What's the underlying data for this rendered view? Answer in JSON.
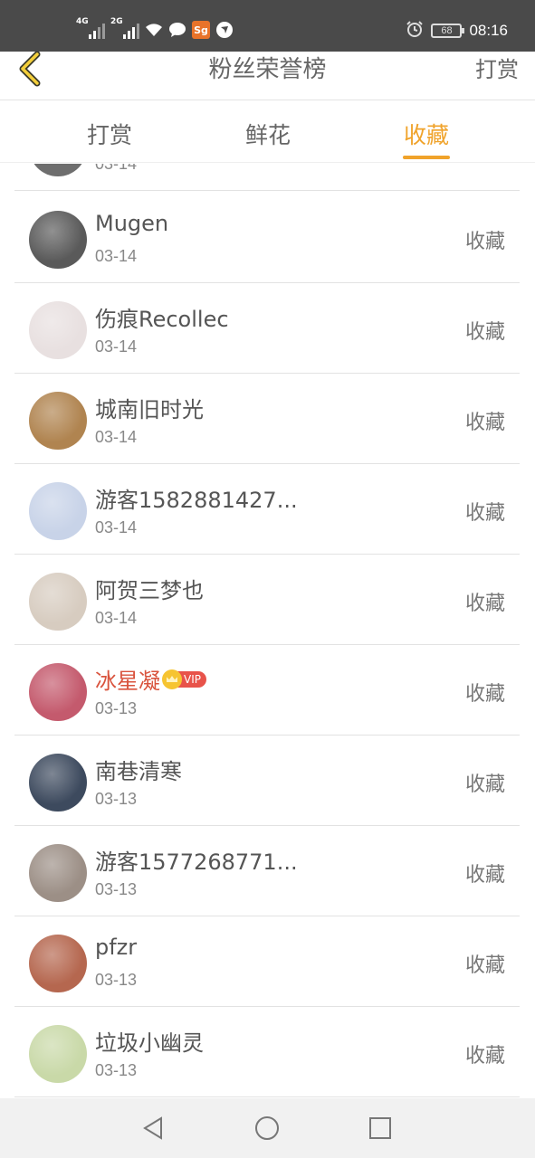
{
  "status_bar": {
    "signal1_label": "4G",
    "signal2_label": "2G",
    "app_badge": "Sg",
    "battery": "68",
    "time": "08:16"
  },
  "header": {
    "title": "粉丝荣誉榜",
    "action": "打赏"
  },
  "tabs": [
    {
      "label": "打赏",
      "active": false
    },
    {
      "label": "鲜花",
      "active": false
    },
    {
      "label": "收藏",
      "active": true
    }
  ],
  "list": {
    "partial_date": "03-14",
    "items": [
      {
        "name": "Mugen",
        "date": "03-14",
        "action": "收藏",
        "vip": false,
        "avatar_color": "#5a5a5a"
      },
      {
        "name": "伤痕Recollec",
        "date": "03-14",
        "action": "收藏",
        "vip": false,
        "avatar_color": "#e8e0e0"
      },
      {
        "name": "城南旧时光",
        "date": "03-14",
        "action": "收藏",
        "vip": false,
        "avatar_color": "#b08450"
      },
      {
        "name": "游客1582881427...",
        "date": "03-14",
        "action": "收藏",
        "vip": false,
        "avatar_color": "#c8d3e8"
      },
      {
        "name": "阿贺三梦也",
        "date": "03-14",
        "action": "收藏",
        "vip": false,
        "avatar_color": "#d7ccc0"
      },
      {
        "name": "冰星凝",
        "date": "03-13",
        "action": "收藏",
        "vip": true,
        "vip_label": "VIP",
        "avatar_color": "#c45a6d"
      },
      {
        "name": "南巷清寒",
        "date": "03-13",
        "action": "收藏",
        "vip": false,
        "avatar_color": "#3d4a5e"
      },
      {
        "name": "游客1577268771...",
        "date": "03-13",
        "action": "收藏",
        "vip": false,
        "avatar_color": "#9c8f86"
      },
      {
        "name": "pfzr",
        "date": "03-13",
        "action": "收藏",
        "vip": false,
        "avatar_color": "#b5674f"
      },
      {
        "name": "垃圾小幽灵",
        "date": "03-13",
        "action": "收藏",
        "vip": false,
        "avatar_color": "#c9d9a8"
      }
    ]
  },
  "colors": {
    "accent": "#f0a32b",
    "vip_name": "#d9533d",
    "status_bar": "#4a4a4a"
  },
  "navbar": {
    "icons": [
      "back-triangle-icon",
      "home-circle-icon",
      "recents-square-icon"
    ]
  }
}
